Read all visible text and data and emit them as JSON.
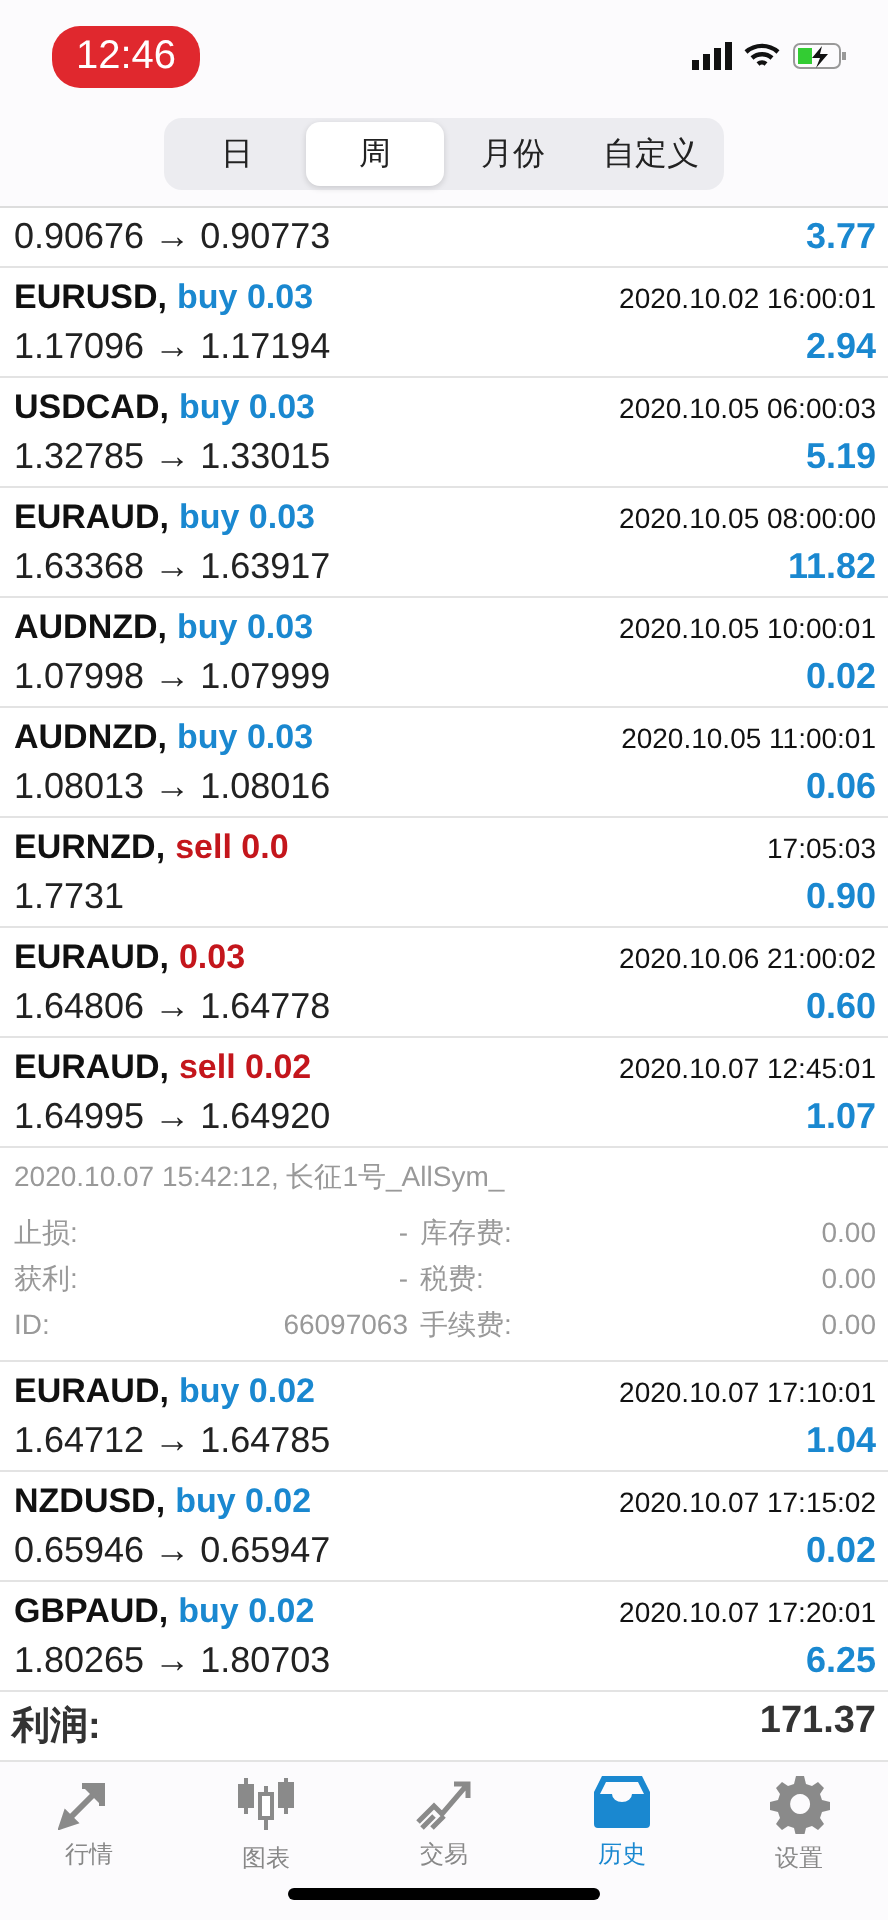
{
  "status_bar": {
    "time": "12:46"
  },
  "segments": [
    {
      "label": "日",
      "selected": false
    },
    {
      "label": "周",
      "selected": true
    },
    {
      "label": "月份",
      "selected": false
    },
    {
      "label": "自定义",
      "selected": false
    }
  ],
  "trades": [
    {
      "prices": "0.90676 → 0.90773",
      "profit": "3.77"
    },
    {
      "symbol": "EURUSD,",
      "color": "#1a88d0",
      "order": "buy 0.03",
      "time": "2020.10.02 16:00:01",
      "prices": "1.17096 → 1.17194",
      "profit": "2.94"
    },
    {
      "symbol": "USDCAD,",
      "color": "#1a88d0",
      "order": "buy 0.03",
      "time": "2020.10.05 06:00:03",
      "prices": "1.32785 → 1.33015",
      "profit": "5.19"
    },
    {
      "symbol": "EURAUD,",
      "color": "#1a88d0",
      "order": "buy 0.03",
      "time": "2020.10.05 08:00:00",
      "prices": "1.63368 → 1.63917",
      "profit": "11.82"
    },
    {
      "symbol": "AUDNZD,",
      "color": "#1a88d0",
      "order": "buy 0.03",
      "time": "2020.10.05 10:00:01",
      "prices": "1.07998 → 1.07999",
      "profit": "0.02"
    },
    {
      "symbol": "AUDNZD,",
      "color": "#1a88d0",
      "order": "buy 0.03",
      "time": "2020.10.05 11:00:01",
      "prices": "1.08013 → 1.08016",
      "profit": "0.06"
    },
    {
      "symbol": "EURNZD,",
      "color": "#c4161c",
      "order": "sell 0.0",
      "time": "17:05:03",
      "prices": "1.7731",
      "profit": "0.90"
    },
    {
      "symbol": "EURAUD,",
      "color": "#c4161c",
      "order": "0.03",
      "time": "2020.10.06 21:00:02",
      "prices": "1.64806 → 1.64778",
      "profit": "0.60"
    },
    {
      "symbol": "EURAUD,",
      "color": "#c4161c",
      "order": "sell 0.02",
      "time": "2020.10.07 12:45:01",
      "prices": "1.64995 → 1.64920",
      "profit": "1.07",
      "expanded": true,
      "details": {
        "comment": "2020.10.07 15:42:12, 长征1号_AllSym_",
        "fields": [
          [
            "止损:",
            "-",
            "库存费:",
            "0.00"
          ],
          [
            "获利:",
            "-",
            "税费:",
            "0.00"
          ],
          [
            "ID:",
            "66097063",
            "手续费:",
            "0.00"
          ]
        ]
      }
    },
    {
      "symbol": "EURAUD,",
      "color": "#1a88d0",
      "order": "buy 0.02",
      "time": "2020.10.07 17:10:01",
      "prices": "1.64712 → 1.64785",
      "profit": "1.04"
    },
    {
      "symbol": "NZDUSD,",
      "color": "#1a88d0",
      "order": "buy 0.02",
      "time": "2020.10.07 17:15:02",
      "prices": "0.65946 → 0.65947",
      "profit": "0.02"
    },
    {
      "symbol": "GBPAUD,",
      "color": "#1a88d0",
      "order": "buy 0.02",
      "time": "2020.10.07 17:20:01",
      "prices": "1.80265 → 1.80703",
      "profit": "6.25"
    }
  ],
  "total": {
    "label": "利润:",
    "value": "171.37"
  },
  "tab_bar": [
    {
      "label": "行情",
      "kind": "quotes",
      "selected": false
    },
    {
      "label": "图表",
      "kind": "chart",
      "selected": false
    },
    {
      "label": "交易",
      "kind": "trade",
      "selected": false
    },
    {
      "label": "历史",
      "kind": "history",
      "selected": true
    },
    {
      "label": "设置",
      "kind": "settings",
      "selected": false
    }
  ]
}
